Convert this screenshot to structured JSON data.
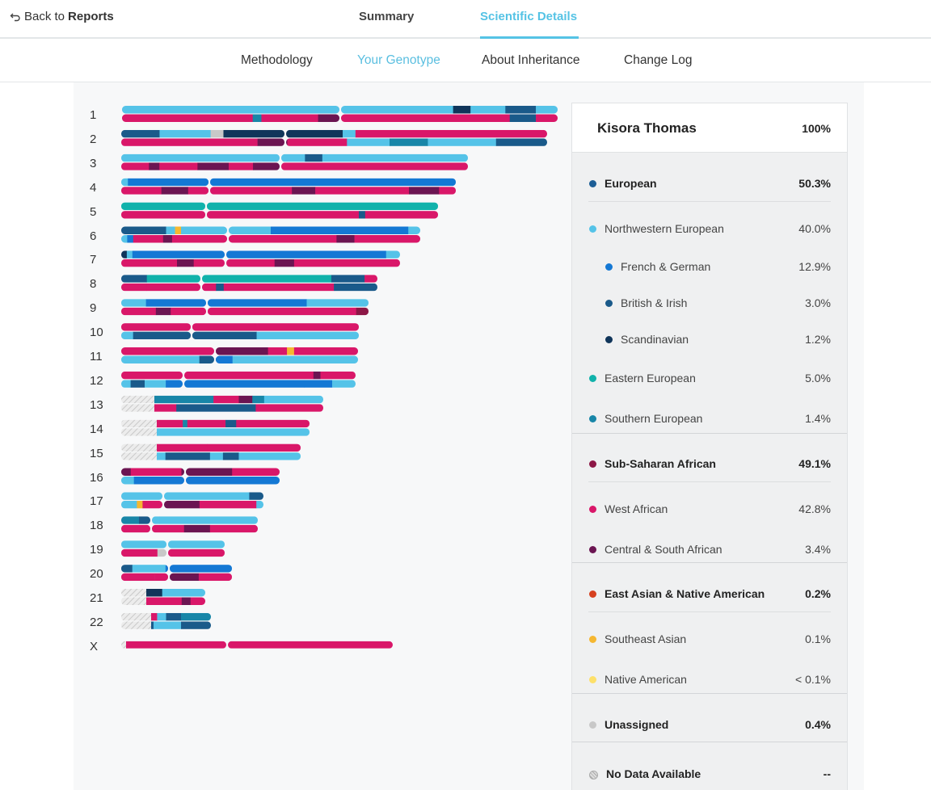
{
  "nav": {
    "back_prefix": "Back to",
    "back_target": "Reports",
    "tabs": [
      {
        "label": "Summary",
        "active": false
      },
      {
        "label": "Scientific Details",
        "active": true
      }
    ]
  },
  "subnav": [
    {
      "label": "Methodology",
      "active": false
    },
    {
      "label": "Your Genotype",
      "active": true
    },
    {
      "label": "About Inheritance",
      "active": false
    },
    {
      "label": "Change Log",
      "active": false
    }
  ],
  "colors": {
    "european": "#1d5e96",
    "northwestern": "#55c3e8",
    "french_german": "#1478d4",
    "british_irish": "#1a5a8a",
    "scandinavian": "#10355a",
    "eastern": "#11b2ab",
    "southern": "#1886a8",
    "subsaharan": "#8c1746",
    "west_african": "#d91769",
    "central_south": "#6b1552",
    "east_asian_native": "#d6401f",
    "southeast_asian": "#f5b731",
    "native_american": "#fde06a",
    "unassigned": "#c8c8c8",
    "nodata": "#d2d2d2"
  },
  "chromosomes": [
    "1",
    "2",
    "3",
    "4",
    "5",
    "6",
    "7",
    "8",
    "9",
    "10",
    "11",
    "12",
    "13",
    "14",
    "15",
    "16",
    "17",
    "18",
    "19",
    "20",
    "21",
    "22",
    "X"
  ],
  "legend": {
    "person": "Kisora Thomas",
    "total": "100%",
    "rows": [
      {
        "label": "European",
        "value": "50.3%",
        "bold": true,
        "indent": 0,
        "color": "#1d5e96"
      },
      {
        "label": "Northwestern European",
        "value": "40.0%",
        "bold": false,
        "indent": 0,
        "color": "#55c3e8"
      },
      {
        "label": "French & German",
        "value": "12.9%",
        "bold": false,
        "indent": 1,
        "color": "#1478d4"
      },
      {
        "label": "British & Irish",
        "value": "3.0%",
        "bold": false,
        "indent": 1,
        "color": "#1a5a8a"
      },
      {
        "label": "Scandinavian",
        "value": "1.2%",
        "bold": false,
        "indent": 1,
        "color": "#10355a"
      },
      {
        "label": "Eastern European",
        "value": "5.0%",
        "bold": false,
        "indent": 0,
        "color": "#11b2ab"
      },
      {
        "label": "Southern European",
        "value": "1.4%",
        "bold": false,
        "indent": 0,
        "color": "#1886a8"
      },
      {
        "label": "Sub-Saharan African",
        "value": "49.1%",
        "bold": true,
        "indent": 0,
        "color": "#8c1746"
      },
      {
        "label": "West African",
        "value": "42.8%",
        "bold": false,
        "indent": 0,
        "color": "#d91769"
      },
      {
        "label": "Central & South African",
        "value": "3.4%",
        "bold": false,
        "indent": 0,
        "color": "#6b1552"
      },
      {
        "label": "East Asian & Native American",
        "value": "0.2%",
        "bold": true,
        "indent": 0,
        "color": "#d6401f"
      },
      {
        "label": "Southeast Asian",
        "value": "0.1%",
        "bold": false,
        "indent": 0,
        "color": "#f5b731"
      },
      {
        "label": "Native American",
        "value": "< 0.1%",
        "bold": false,
        "indent": 0,
        "color": "#fde06a"
      },
      {
        "label": "Unassigned",
        "value": "0.4%",
        "bold": true,
        "indent": 0,
        "color": "#c8c8c8"
      },
      {
        "label": "No Data Available",
        "value": "--",
        "bold": true,
        "indent": 0,
        "color": "#d2d2d2"
      }
    ]
  }
}
